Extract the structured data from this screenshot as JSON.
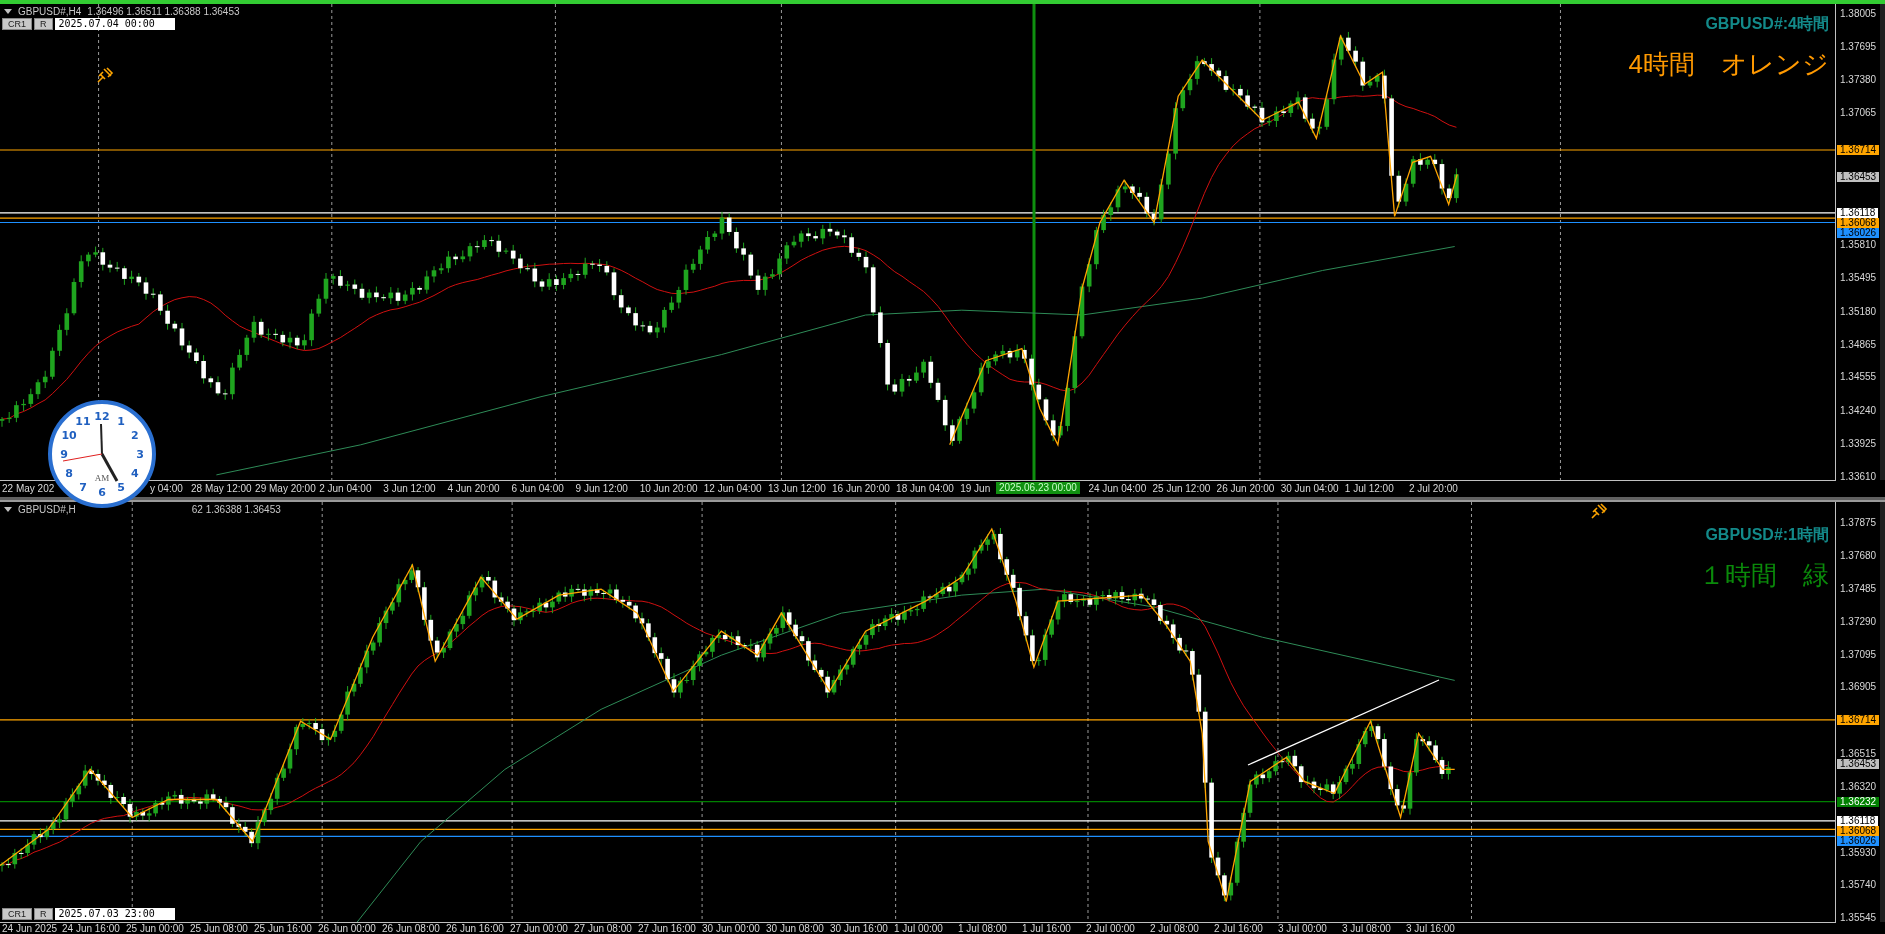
{
  "clock": {
    "numbers": [
      "12",
      "11",
      "1",
      "10",
      "2",
      "9",
      "3",
      "8",
      "4",
      "7",
      "5",
      "6"
    ],
    "period": "AM"
  },
  "panels": [
    {
      "active": true,
      "header": [
        "GBPUSD#,H4",
        "1.36496 1.36511 1.36388 1.36453"
      ],
      "buttons": [
        "CR1",
        "R"
      ],
      "time_field": "2025.07.04 00:00",
      "title": "GBPUSD#:4時間",
      "caption": "4時間　オレンジ",
      "color": "#ff9900",
      "price_ticks": [
        "1.38005",
        "1.37695",
        "1.37380",
        "1.37065",
        "1.35810",
        "1.35495",
        "1.35180",
        "1.34865",
        "1.34555",
        "1.34240",
        "1.33925",
        "1.33610"
      ],
      "price_tags": [
        {
          "label": "1.36714",
          "color": "#ffa500",
          "kind": "level"
        },
        {
          "label": "1.36453",
          "color": "#c0c0c0",
          "kind": "bid"
        },
        {
          "label": "1.36118",
          "color": "#ffffff",
          "kind": "level"
        },
        {
          "label": "1.36068",
          "color": "#ffa500",
          "kind": "level"
        },
        {
          "label": "1.36026",
          "color": "#1e90ff",
          "kind": "level"
        }
      ],
      "time_ticks": [
        "22 May 202",
        "y 04:00",
        "28 May 12:00",
        "29 May 20:00",
        "2 Jun 04:00",
        "3 Jun 12:00",
        "4 Jun 20:00",
        "6 Jun 04:00",
        "9 Jun 12:00",
        "10 Jun 20:00",
        "12 Jun 04:00",
        "13 Jun 12:00",
        "16 Jun 20:00",
        "18 Jun 04:00",
        "19 Jun",
        "24 Jun 04:00",
        "25 Jun 12:00",
        "26 Jun 20:00",
        "30 Jun 04:00",
        "1 Jul 12:00",
        "2 Jul 20:00"
      ],
      "cursor_time": "2025.06.23 00:00"
    },
    {
      "active": false,
      "header": [
        "GBPUSD#,H",
        "62 1.36388 1.36453"
      ],
      "buttons": [
        "CR1",
        "R"
      ],
      "time_field": "2025.07.03 23:00",
      "title": "GBPUSD#:1時間",
      "caption": "１時間　緑",
      "color": "#0a8a0a",
      "price_ticks": [
        "1.37875",
        "1.37680",
        "1.37485",
        "1.37290",
        "1.37095",
        "1.36905",
        "1.36515",
        "1.36320",
        "1.35930",
        "1.35740",
        "1.35545"
      ],
      "price_tags": [
        {
          "label": "1.36714",
          "color": "#ffa500",
          "kind": "level"
        },
        {
          "label": "1.36453",
          "color": "#c0c0c0",
          "kind": "bid"
        },
        {
          "label": "1.36232",
          "color": "#008000",
          "kind": "level"
        },
        {
          "label": "1.36118",
          "color": "#ffffff",
          "kind": "level"
        },
        {
          "label": "1.36068",
          "color": "#ffa500",
          "kind": "level"
        },
        {
          "label": "1.36026",
          "color": "#1e90ff",
          "kind": "level"
        }
      ],
      "time_ticks": [
        "24 Jun 2025",
        "24 Jun 16:00",
        "25 Jun 00:00",
        "25 Jun 08:00",
        "25 Jun 16:00",
        "26 Jun 00:00",
        "26 Jun 08:00",
        "26 Jun 16:00",
        "27 Jun 00:00",
        "27 Jun 08:00",
        "27 Jun 16:00",
        "30 Jun 00:00",
        "30 Jun 08:00",
        "30 Jun 16:00",
        "1 Jul 00:00",
        "1 Jul 08:00",
        "1 Jul 16:00",
        "2 Jul 00:00",
        "2 Jul 08:00",
        "2 Jul 16:00",
        "3 Jul 00:00",
        "3 Jul 08:00",
        "3 Jul 16:00"
      ]
    }
  ]
}
